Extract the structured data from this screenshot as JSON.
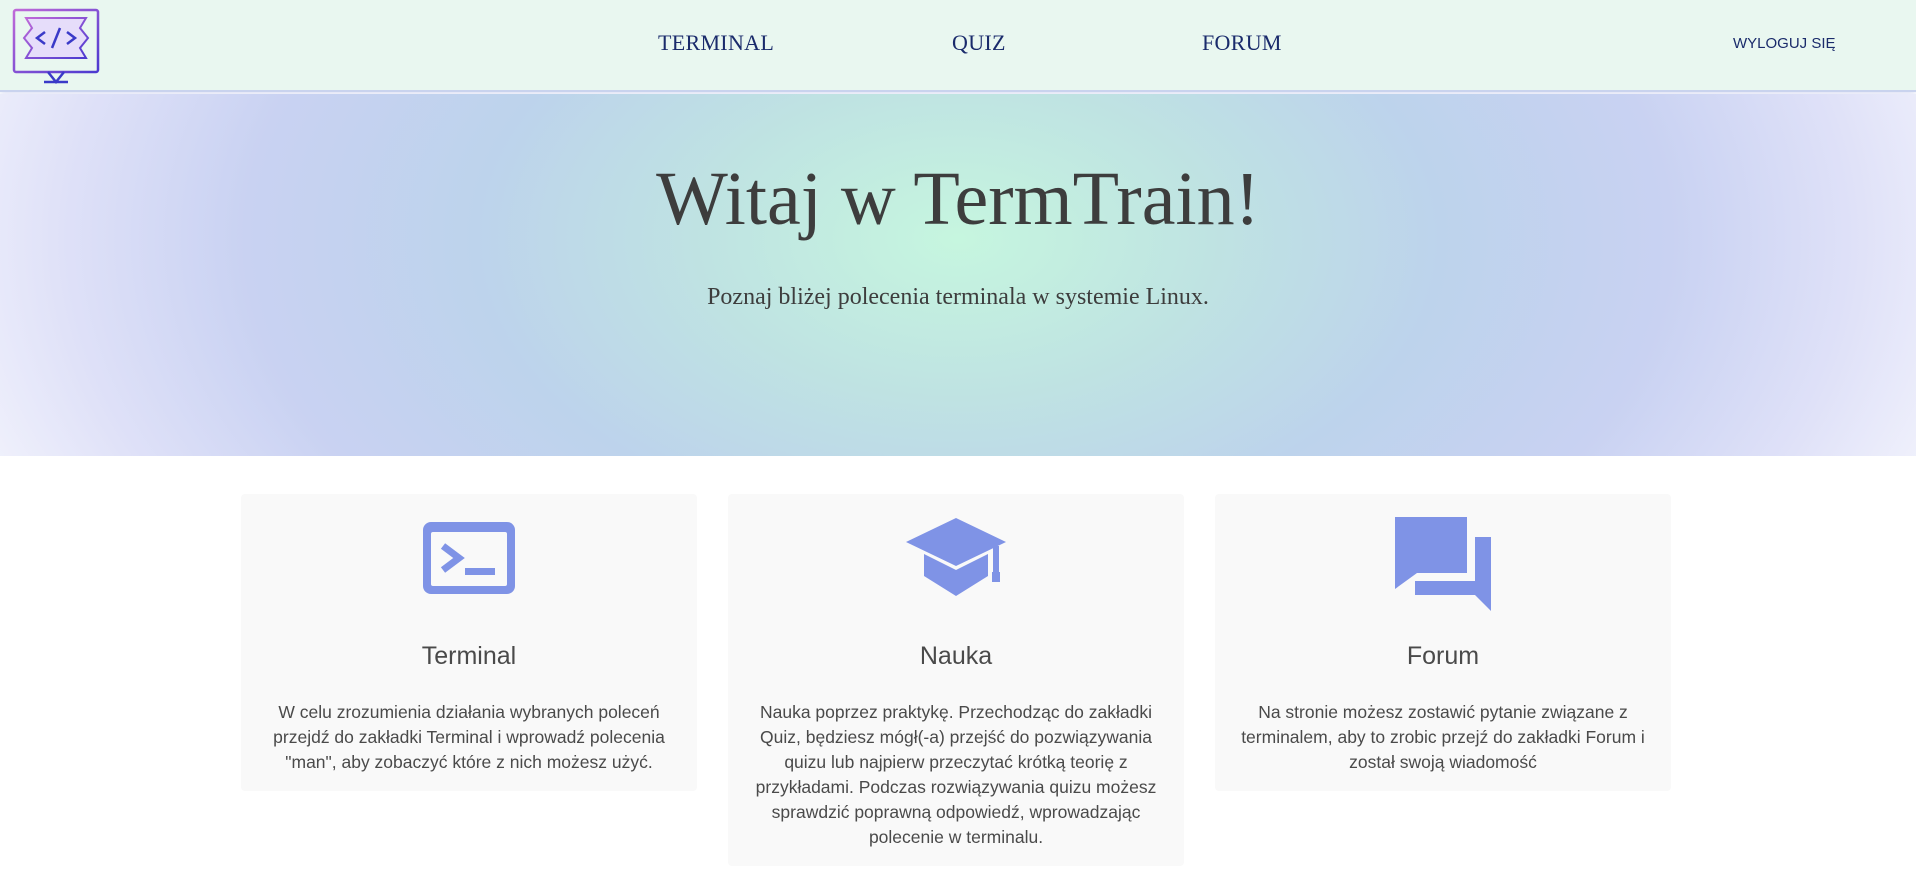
{
  "header": {
    "logo_icon": "code-monitor-icon",
    "nav": [
      {
        "label": "TERMINAL"
      },
      {
        "label": "QUIZ"
      },
      {
        "label": "FORUM"
      }
    ],
    "logout_label": "WYLOGUJ SIĘ"
  },
  "hero": {
    "title": "Witaj w TermTrain!",
    "subtitle": "Poznaj bliżej polecenia terminala w systemie Linux."
  },
  "cards": [
    {
      "icon": "terminal-icon",
      "title": "Terminal",
      "text": "W celu zrozumienia działania wybranych poleceń przejdź do zakładki Terminal i wprowadź polecenia \"man\", aby zobaczyć które z nich możesz użyć."
    },
    {
      "icon": "graduation-cap-icon",
      "title": "Nauka",
      "text": "Nauka poprzez praktykę. Przechodząc do zakładki Quiz, będziesz mógł(-a) przejść do pozwiązywania quizu lub najpierw przeczytać krótką teorię z przykładami. Podczas rozwiązywania quizu możesz sprawdzić poprawną odpowiedź, wprowadzając polecenie w terminalu."
    },
    {
      "icon": "chat-bubbles-icon",
      "title": "Forum",
      "text": "Na stronie możesz zostawić pytanie związane z terminalem, aby to zrobic przejź do zakładki Forum i został swoją wiadomość"
    }
  ],
  "colors": {
    "header_bg": "#e9f7f0",
    "nav_text": "#1a2b6b",
    "icon_accent": "#7f93e6",
    "logo_purple": "#7b4fd6",
    "card_bg": "#f9f9f9"
  }
}
